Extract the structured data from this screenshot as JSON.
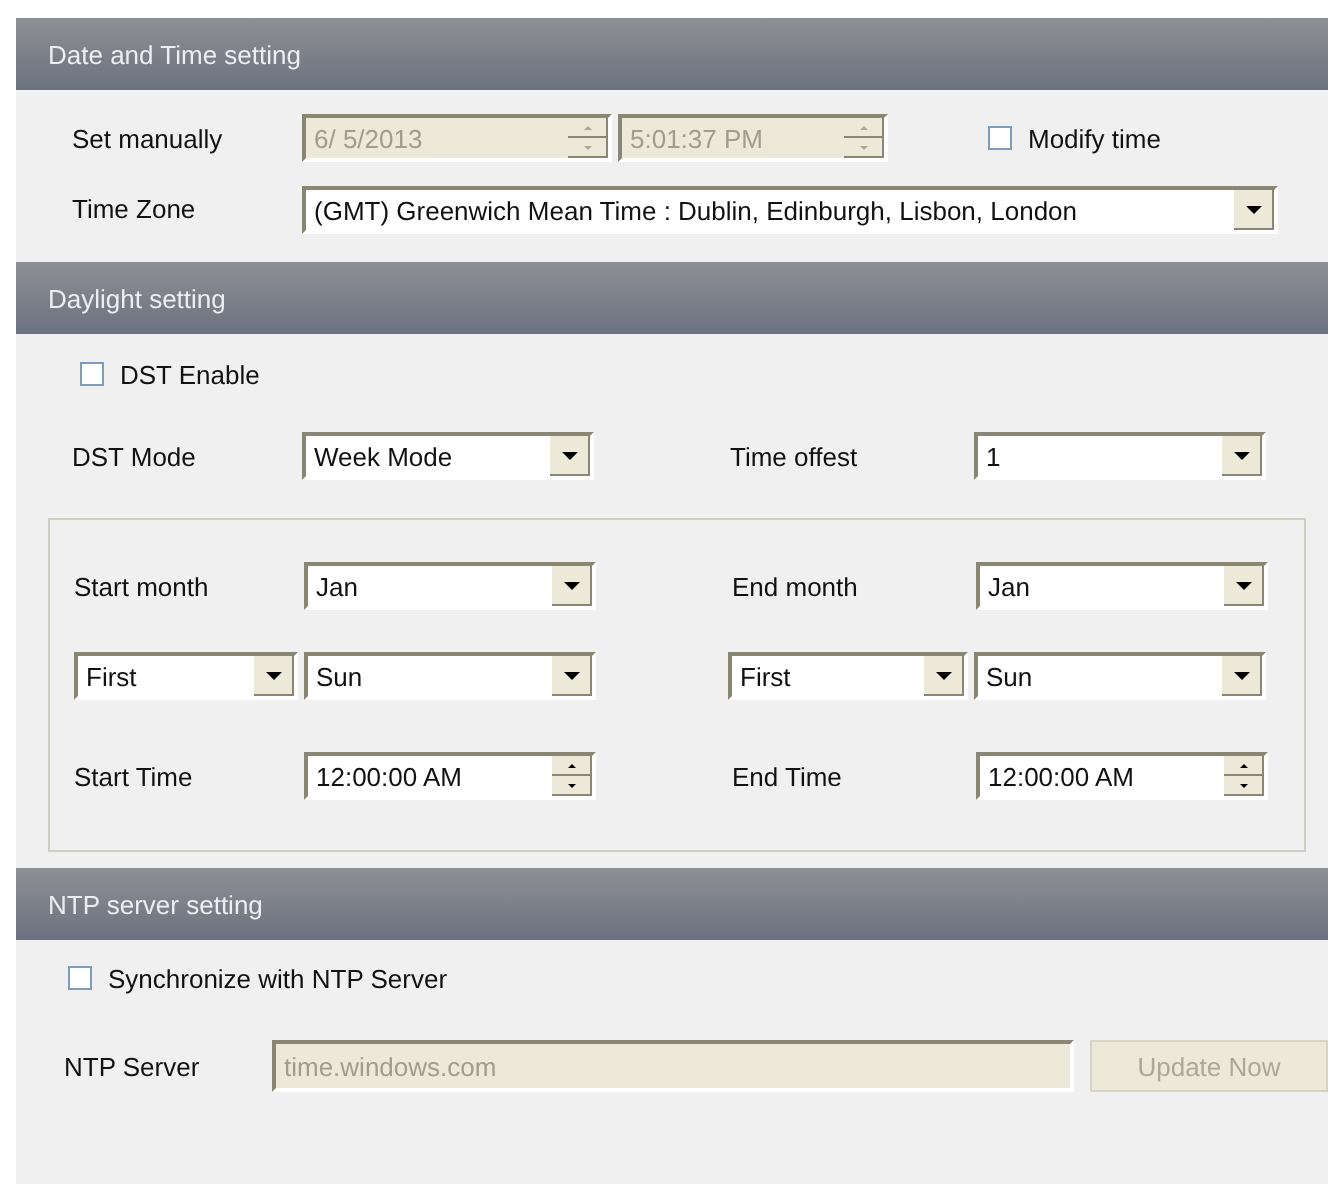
{
  "date_time": {
    "title": "Date and Time setting",
    "set_manually": {
      "label": "Set manually",
      "date": {
        "value": "6/  5/2013",
        "disabled": true
      },
      "time": {
        "value": "5:01:37 PM",
        "disabled": true
      }
    },
    "modify_time": {
      "label": "Modify time",
      "checked": false
    },
    "time_zone": {
      "label": "Time Zone",
      "value": "(GMT) Greenwich Mean Time : Dublin, Edinburgh, Lisbon, London"
    }
  },
  "daylight": {
    "title": "Daylight setting",
    "dst_enable": {
      "label": "DST Enable",
      "checked": false
    },
    "dst_mode": {
      "label": "DST Mode",
      "value": "Week Mode"
    },
    "time_offset": {
      "label": "Time offest",
      "value": "1"
    },
    "periods": [
      {
        "month_label": "Start month",
        "month": "Jan",
        "week": "First",
        "day": "Sun",
        "time_label": "Start Time",
        "time": "12:00:00 AM"
      },
      {
        "month_label": "End month",
        "month": "Jan",
        "week": "First",
        "day": "Sun",
        "time_label": "End Time",
        "time": "12:00:00 AM"
      }
    ]
  },
  "ntp": {
    "title": "NTP server setting",
    "sync": {
      "label": "Synchronize with NTP Server",
      "checked": false
    },
    "server": {
      "label": "NTP Server",
      "value": "time.windows.com",
      "disabled": true
    },
    "update_button": {
      "label": "Update Now",
      "disabled": true
    }
  }
}
